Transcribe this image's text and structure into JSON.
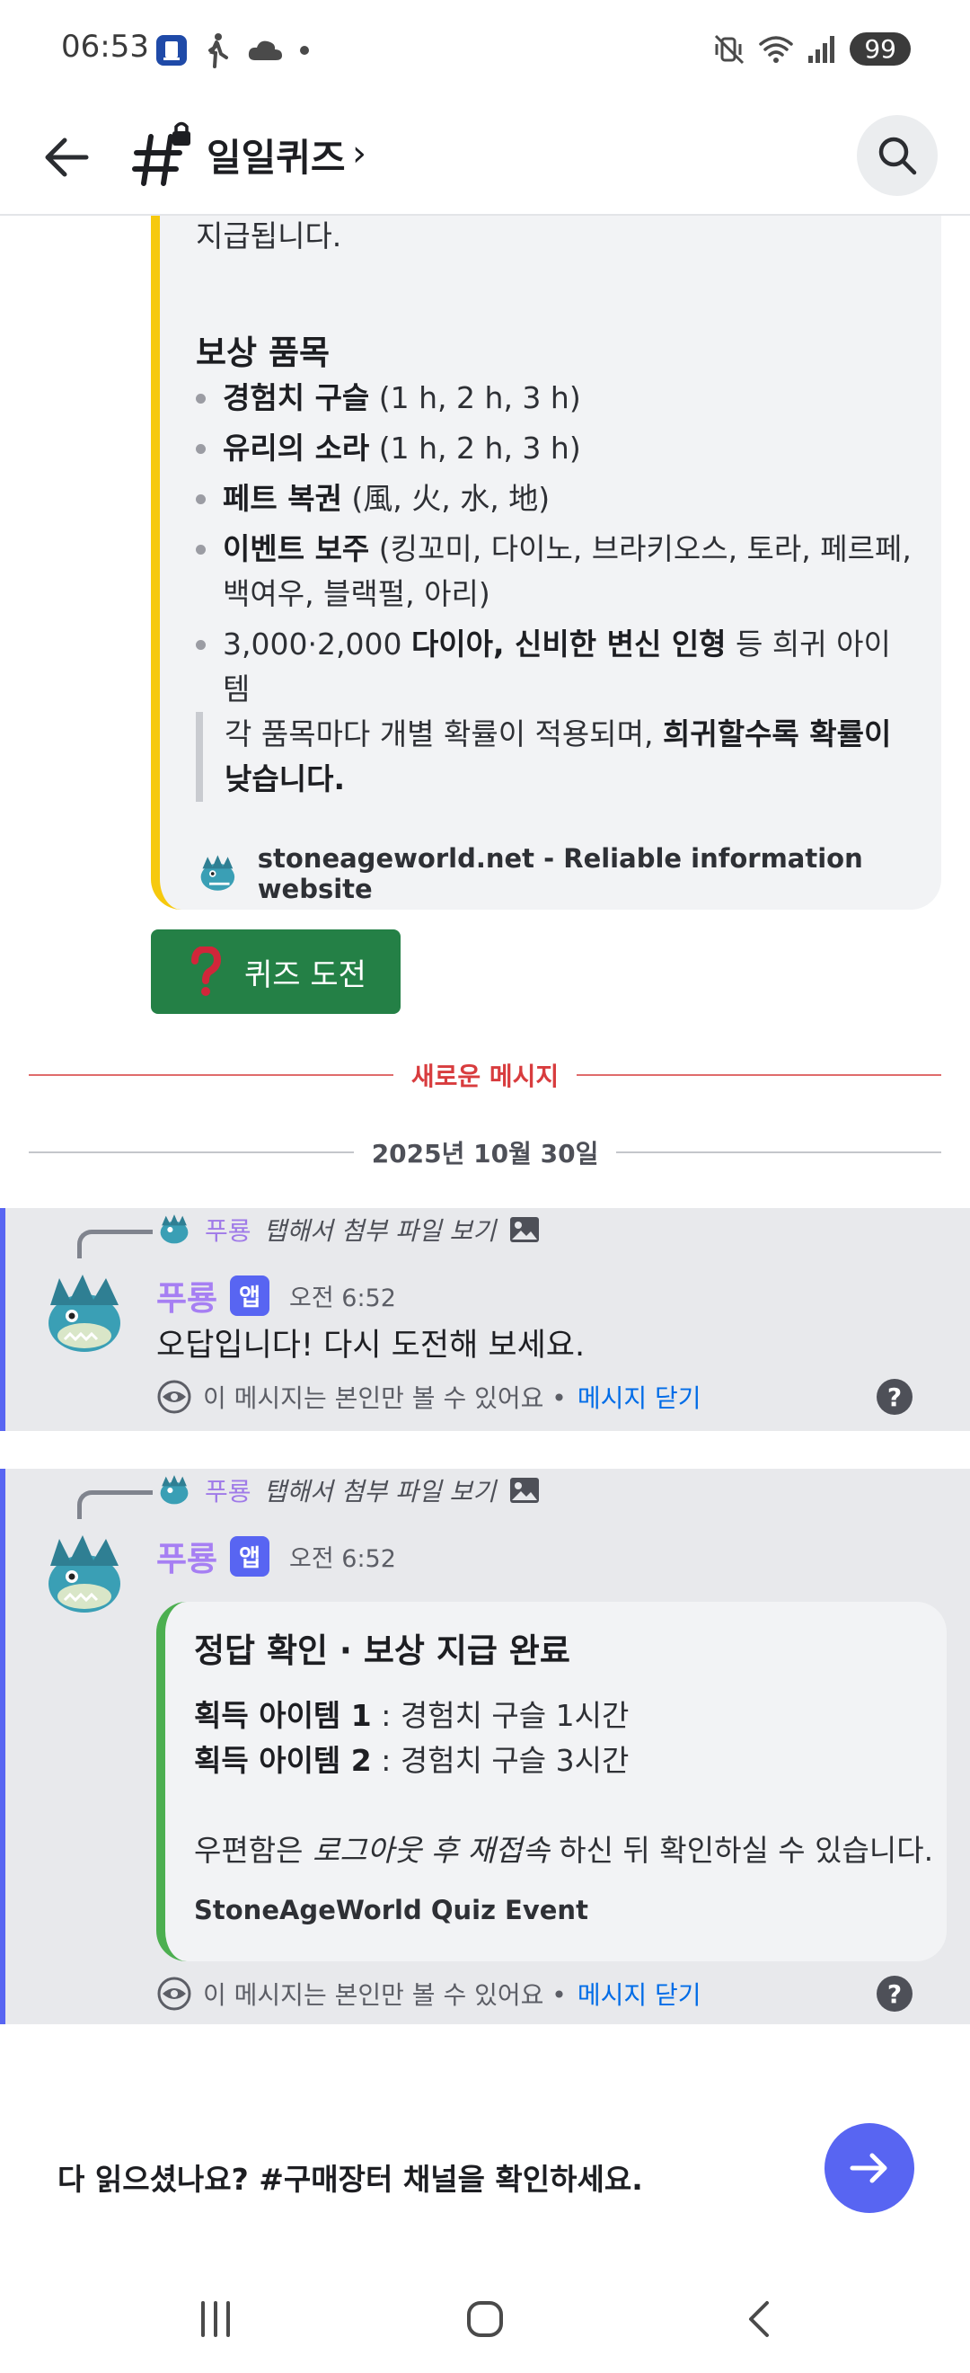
{
  "status_bar": {
    "time": "06:53",
    "battery": "99",
    "icons_left": [
      "app-notification-icon",
      "walking-icon",
      "cloud-icon",
      "dot-icon"
    ],
    "icons_right": [
      "mute-vibrate-icon",
      "wifi-icon",
      "signal-icon",
      "battery-icon"
    ]
  },
  "header": {
    "channel_name": "일일퀴즈",
    "chevron": "›",
    "icons": [
      "back-arrow-icon",
      "locked-hash-icon",
      "search-icon"
    ]
  },
  "embed1": {
    "accent_color": "#f6c90e",
    "top_line": "지급됩니다.",
    "section_title": "보상 품목",
    "items": [
      {
        "bold": "경험치 구슬",
        "rest": " (1 h, 2 h, 3 h)"
      },
      {
        "bold": "유리의 소라",
        "rest": " (1 h, 2 h, 3 h)"
      },
      {
        "bold": "페트 복권",
        "rest": " (風, 火, 水, 地)"
      },
      {
        "bold": "이벤트 보주",
        "rest": " (킹꼬미, 다이노, 브라키오스, 토라, 페르페, 백여우, 블랙펄, 아리)"
      },
      {
        "pre": "3,000·2,000 ",
        "bold": "다이아, 신비한 변신 인형",
        "rest": " 등 희귀 아이템"
      }
    ],
    "quote_plain": "각 품목마다 개별 확률이 적용되며, ",
    "quote_bold": "희귀할수록 확률이 낮습니다.",
    "footer_text": "stoneageworld.net - Reliable information website"
  },
  "quiz_button": {
    "icon": "red-question-mark-icon",
    "label": "퀴즈 도전",
    "color": "#248046"
  },
  "dividers": {
    "new_messages": "새로운 메시지",
    "date": "2025년 10월 30일"
  },
  "messages": [
    {
      "reply_author": "푸룡",
      "reply_text": "탭해서 첨부 파일 보기",
      "author": "푸룡",
      "badge": "앱",
      "timestamp": "오전 6:52",
      "body": "오답입니다! 다시 도전해 보세요.",
      "ephemeral_text": "이 메시지는 본인만 볼 수 있어요 •",
      "dismiss": "메시지 닫기",
      "help": "?"
    },
    {
      "reply_author": "푸룡",
      "reply_text": "탭해서 첨부 파일 보기",
      "author": "푸룡",
      "badge": "앱",
      "timestamp": "오전 6:52",
      "embed": {
        "accent_color": "#4caf50",
        "title": "정답 확인 · 보상 지급 완료",
        "line1_bold": "획득 아이템 1",
        "line1_rest": " : 경험치 구슬 1시간",
        "line2_bold": "획득 아이템 2",
        "line2_rest": " : 경험치 구슬 3시간",
        "line3_pre": "우편함은 ",
        "line3_italic": "로그아웃 후 재접속",
        "line3_rest": " 하신 뒤 확인하실 수 있습니다.",
        "footer": "StoneAgeWorld Quiz Event"
      },
      "ephemeral_text": "이 메시지는 본인만 볼 수 있어요 •",
      "dismiss": "메시지 닫기",
      "help": "?"
    }
  ],
  "bottom_prompt": {
    "text": "다 읽으셨나요? #구매장터 채널을 확인하세요.",
    "button_icon": "arrow-right-icon",
    "button_color": "#5865f2"
  },
  "nav_bar": {
    "icons": [
      "recent-apps-icon",
      "home-icon",
      "back-icon"
    ]
  }
}
